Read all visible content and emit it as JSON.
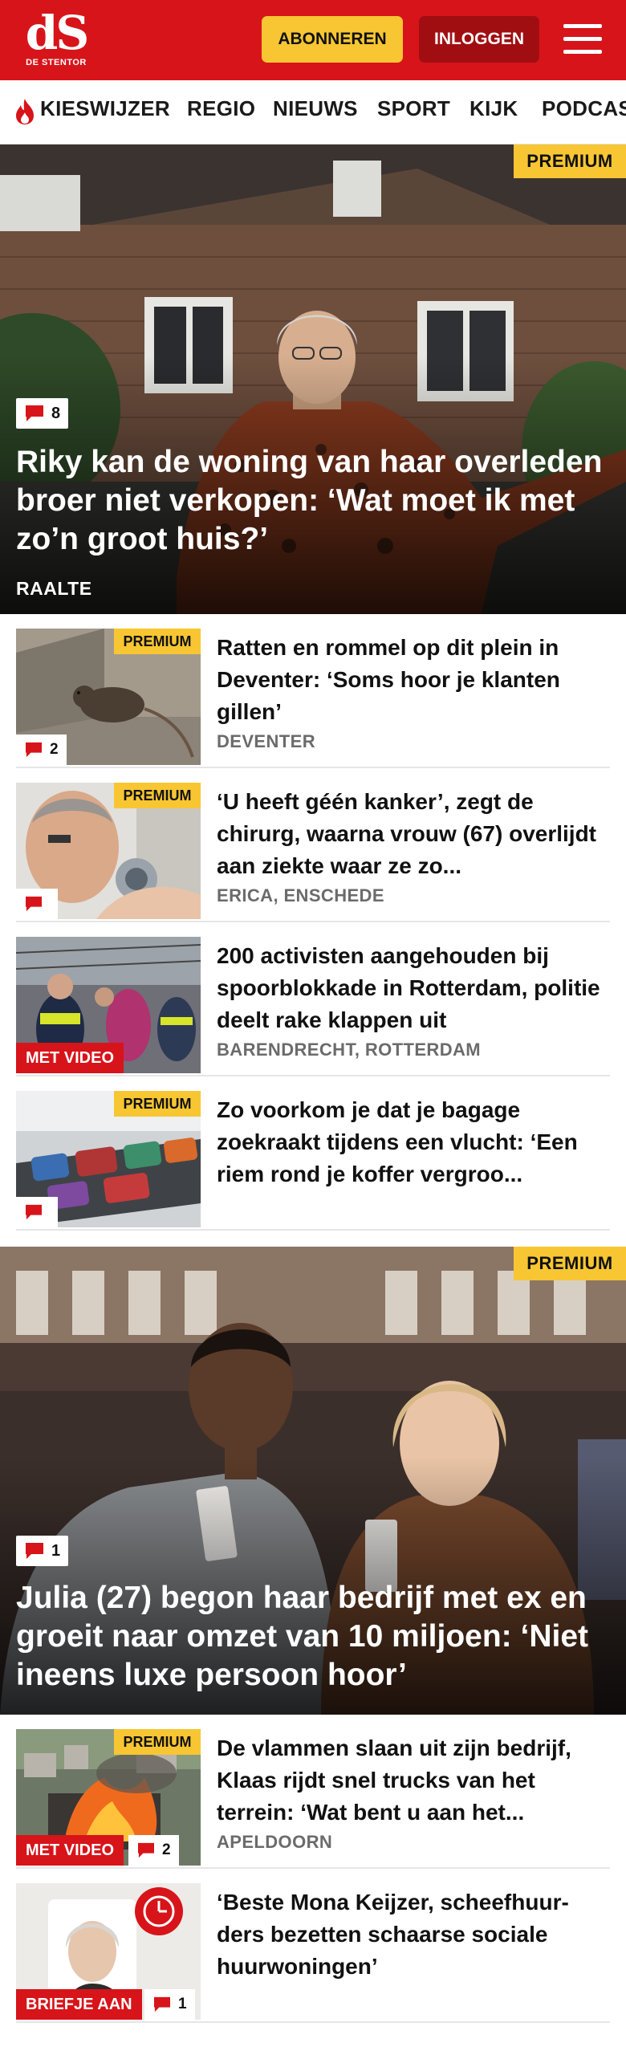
{
  "header": {
    "logo_mark": "dS",
    "logo_sub": "DE STENTOR",
    "subscribe_label": "ABONNEREN",
    "login_label": "INLOGGEN",
    "menu_icon": "hamburger-menu-icon",
    "brand_red": "#d7141a",
    "accent_yellow": "#f7c632"
  },
  "nav": {
    "items": [
      "KIESWIJZER",
      "REGIO",
      "NIEUWS",
      "SPORT",
      "KIJK",
      "PODCAST"
    ]
  },
  "hero1": {
    "premium": "PREMIUM",
    "comments": "8",
    "title": "Riky kan de woning van haar overleden broer niet verkopen: ‘Wat moet ik met zo’n groot huis?’",
    "location": "RAALTE"
  },
  "list1": [
    {
      "premium": "PREMIUM",
      "comments": "2",
      "title": "Ratten en rommel op dit plein in Deventer: ‘Soms hoor je klanten gillen’",
      "location": "DEVENTER"
    },
    {
      "premium": "PREMIUM",
      "comments": "",
      "title": "‘U heeft géén kanker’, zegt de chirurg, waarna vrouw (67) overlijdt aan ziekte waar ze zo...",
      "location": "ERICA, ENSCHEDE"
    },
    {
      "video": "MET VIDEO",
      "title": "200 activisten aangehouden bij spoorblokkade in Rotterdam, politie deelt rake klappen uit",
      "location": "BARENDRECHT, ROTTERDAM"
    },
    {
      "premium": "PREMIUM",
      "comments": "",
      "title": "Zo voorkom je dat je bagage zoekraakt tijdens een vlucht: ‘Een riem rond je koffer vergroo...",
      "location": ""
    }
  ],
  "hero2": {
    "premium": "PREMIUM",
    "comments": "1",
    "title": "Julia (27) begon haar bedrijf met ex en groeit naar omzet van 10 miljoen: ‘Niet ineens luxe persoon hoor’"
  },
  "list2": [
    {
      "premium": "PREMIUM",
      "video": "MET VIDEO",
      "comments": "2",
      "title": "De vlammen slaan uit zijn bedrijf, Klaas rijdt snel trucks van het terrein: ‘Wat bent u aan het...",
      "location": "APELDOORN"
    },
    {
      "video": "BRIEFJE AAN",
      "comments": "1",
      "title": "‘Beste Mona Keijzer, scheefhuur-ders bezetten schaarse sociale huurwoningen’",
      "location": ""
    }
  ]
}
